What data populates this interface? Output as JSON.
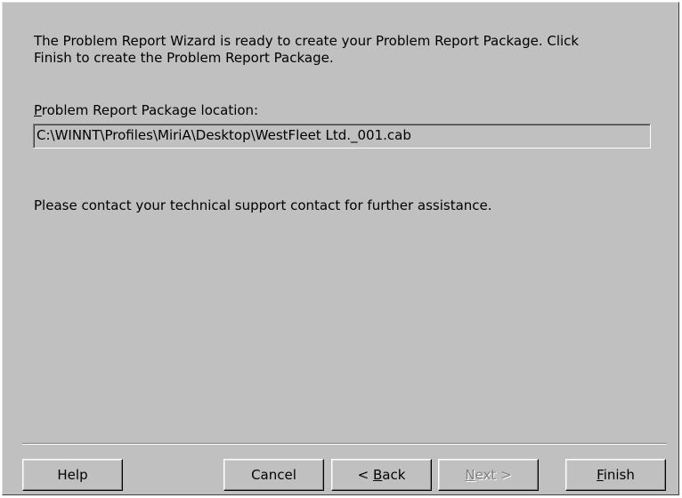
{
  "content": {
    "intro_line1": "The Problem Report Wizard is ready to create your Problem Report Package.  Click",
    "intro_line2": "Finish to create the Problem Report Package.",
    "location_label_accel": "P",
    "location_label_rest": "roblem Report Package location:",
    "location_value": "C:\\WINNT\\Profiles\\MiriA\\Desktop\\WestFleet Ltd._001.cab",
    "contact_text": "Please contact your technical support contact for further assistance."
  },
  "buttons": {
    "help": "Help",
    "cancel": "Cancel",
    "back_prefix": "< ",
    "back_accel": "B",
    "back_rest": "ack",
    "next_accel": "N",
    "next_rest": "ext >",
    "finish_accel": "F",
    "finish_rest": "inish"
  },
  "colors": {
    "face": "#c0c0c0",
    "disabled_text": "#808080"
  }
}
